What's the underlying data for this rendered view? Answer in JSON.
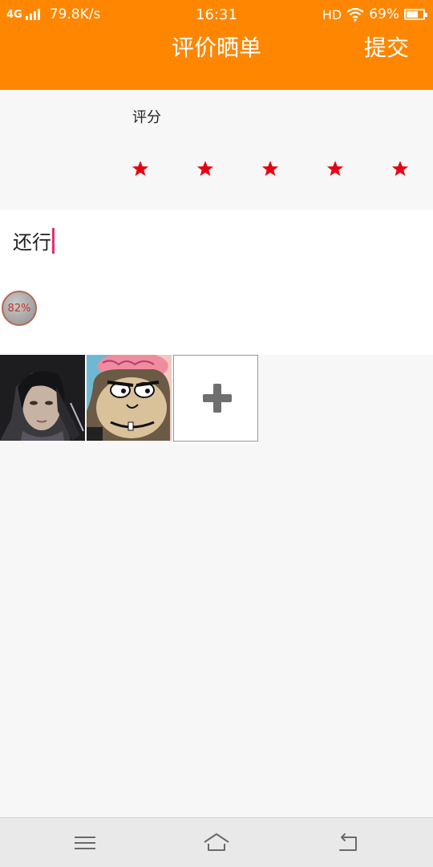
{
  "status_bar": {
    "network": "4G",
    "speed": "79.8K/s",
    "time": "16:31",
    "hd": "HD",
    "battery_text": "69%",
    "battery_level": 0.69
  },
  "header": {
    "title": "评价晒单",
    "submit_label": "提交",
    "background_color": "#fe8600"
  },
  "rating": {
    "label": "评分",
    "stars": 5,
    "max_stars": 5,
    "star_color": "#e60012"
  },
  "comment": {
    "text": "还行"
  },
  "upload_badge": {
    "text": "82%"
  },
  "images": {
    "items": [
      "photo-portrait",
      "cartoon-monkey"
    ],
    "add_icon": "plus-icon"
  },
  "bottom_nav": {
    "icons": [
      "menu-icon",
      "home-icon",
      "back-icon"
    ]
  }
}
